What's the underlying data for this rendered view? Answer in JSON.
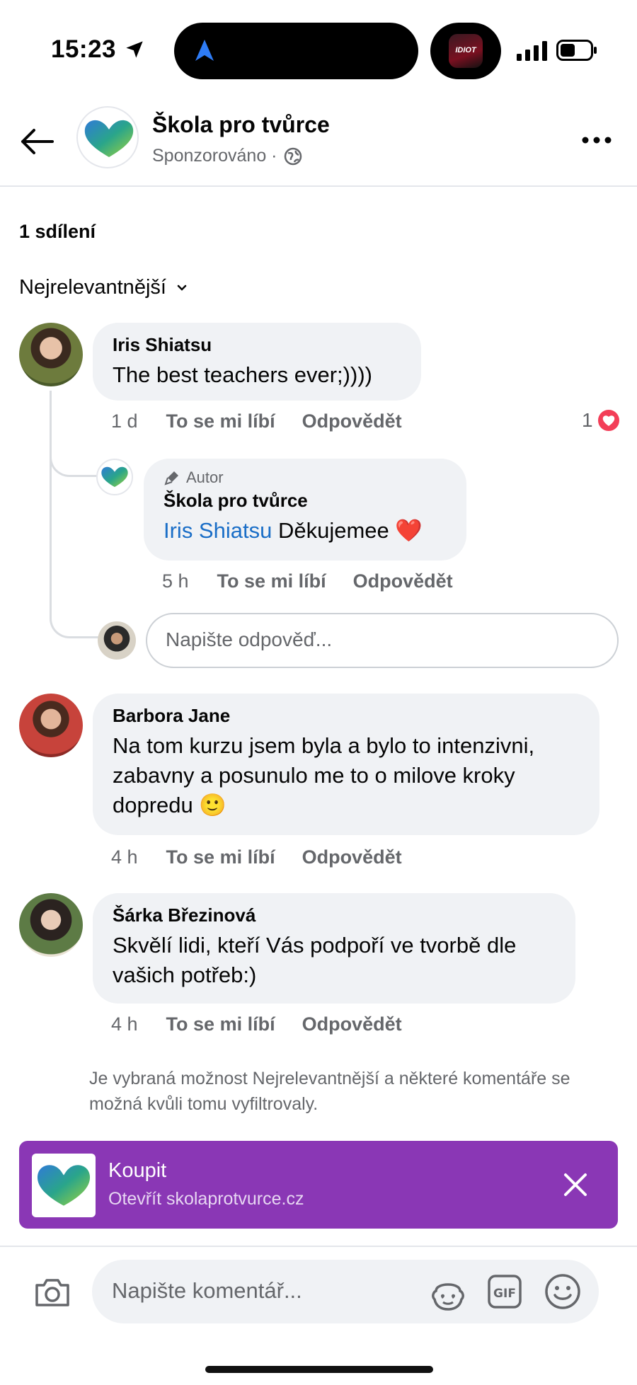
{
  "status_bar": {
    "time": "15:23",
    "app_badge": "IDIOT"
  },
  "header": {
    "page_name": "Škola pro tvůrce",
    "meta": "Sponzorováno ·"
  },
  "shares": "1 sdílení",
  "sort": {
    "label": "Nejrelevantnější"
  },
  "comments": [
    {
      "author": "Iris Shiatsu",
      "text": "The best teachers ever;))))",
      "time": "1 d",
      "like_label": "To se mi líbí",
      "reply_label": "Odpovědět",
      "reaction_count": "1",
      "replies": [
        {
          "author_badge": "Autor",
          "author": "Škola pro tvůrce",
          "mention": "Iris Shiatsu",
          "text": "Děkujemee",
          "emoji": "❤️",
          "time": "5 h",
          "like_label": "To se mi líbí",
          "reply_label": "Odpovědět"
        }
      ],
      "reply_placeholder": "Napište odpověď..."
    },
    {
      "author": "Barbora Jane",
      "text_lines": [
        "Na tom kurzu jsem byla a bylo to intenzivni,",
        "zabavny a posunulo me to o milove kroky",
        "dopredu"
      ],
      "emoji": "🙂",
      "time": "4 h",
      "like_label": "To se mi líbí",
      "reply_label": "Odpovědět"
    },
    {
      "author": "Šárka Březinová",
      "text_lines": [
        "Skvělí lidi, kteří Vás podpoří ve tvorbě dle",
        "vašich potřeb:)"
      ],
      "time": "4 h",
      "like_label": "To se mi líbí",
      "reply_label": "Odpovědět"
    }
  ],
  "filter_note": "Je vybraná možnost Nejrelevantnější a některé komentáře se možná kvůli tomu vyfiltrovaly.",
  "ad": {
    "title": "Koupit",
    "url": "Otevřít skolaprotvurce.cz",
    "color": "#8a37b5"
  },
  "composer": {
    "placeholder": "Napište komentář...",
    "gif_label": "GIF"
  },
  "colors": {
    "mention": "#1a6ec7",
    "secondary_text": "#65676b",
    "reaction_heart": "#f33e58"
  }
}
